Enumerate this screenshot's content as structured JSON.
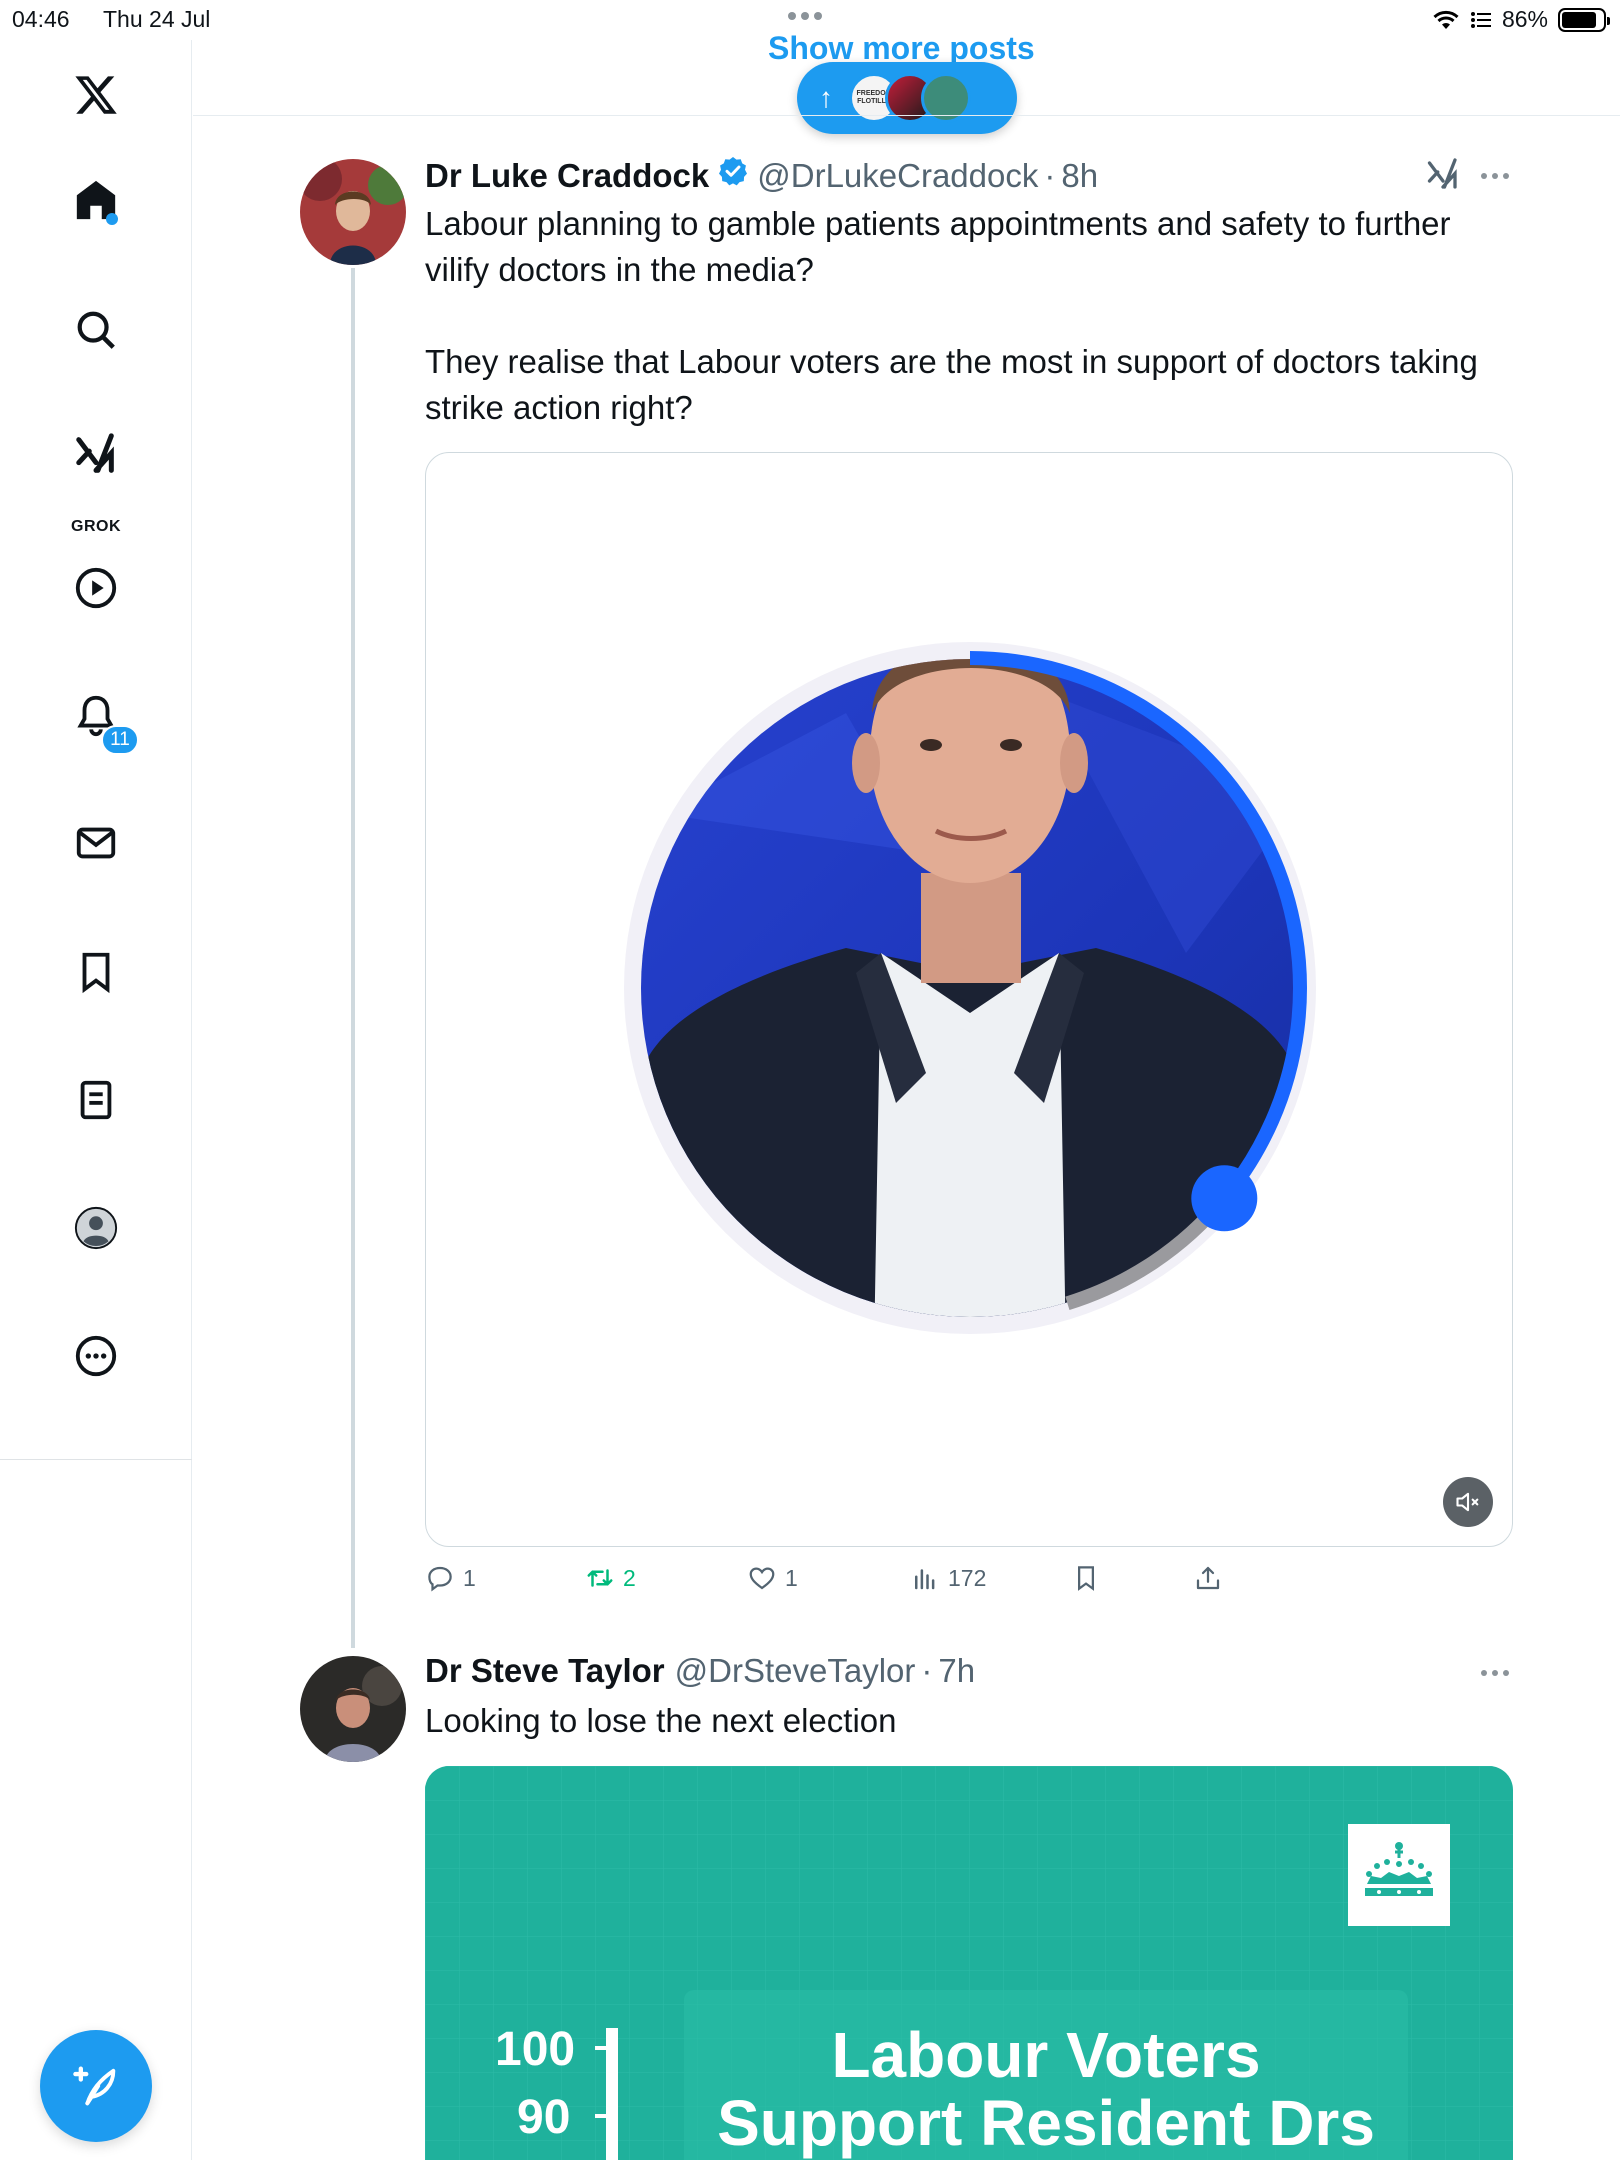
{
  "status_bar": {
    "time": "04:46",
    "date": "Thu 24 Jul",
    "battery": "86%",
    "battery_level": 0.86
  },
  "sidebar": {
    "items": [
      {
        "icon": "x-logo-icon"
      },
      {
        "icon": "home-icon",
        "has_dot": true
      },
      {
        "icon": "search-icon"
      },
      {
        "icon": "grok-icon",
        "label": "GROK"
      },
      {
        "icon": "video-play-icon"
      },
      {
        "icon": "bell-icon",
        "badge": "11"
      },
      {
        "icon": "mail-icon"
      },
      {
        "icon": "bookmark-icon"
      },
      {
        "icon": "lists-icon"
      },
      {
        "icon": "profile-icon"
      },
      {
        "icon": "more-circle-icon"
      }
    ],
    "compose_icon": "compose-feather-icon"
  },
  "banner": {
    "show_more": "Show more posts",
    "avatar_texts": [
      "FREEDOM FLOTILLA",
      "",
      ""
    ]
  },
  "tweets": [
    {
      "name": "Dr Luke Craddock",
      "verified": true,
      "handle": "@DrLukeCraddock",
      "sep": "·",
      "time": "8h",
      "text": "Labour planning to gamble patients appointments and safety to further vilify doctors in the media?\n\nThey realise that Labour voters are the most in support of doctors taking strike action right?",
      "video": {
        "progress": 0.36,
        "muted": true
      },
      "stats": {
        "replies": "1",
        "reposts": "2",
        "likes": "1",
        "views": "172"
      }
    },
    {
      "name": "Dr Steve Taylor",
      "verified": false,
      "handle": "@DrSteveTaylor",
      "sep": "·",
      "time": "7h",
      "text": "Looking to lose the next election",
      "image": {
        "heading_line1": "Labour Voters",
        "heading_line2": "Support Resident Drs",
        "ticks": [
          "100",
          "90"
        ]
      }
    }
  ],
  "colors": {
    "accent": "#1d9bf0",
    "repost": "#00ba7c",
    "text_secondary": "#536471",
    "chart_bg": "#1fb19c"
  }
}
